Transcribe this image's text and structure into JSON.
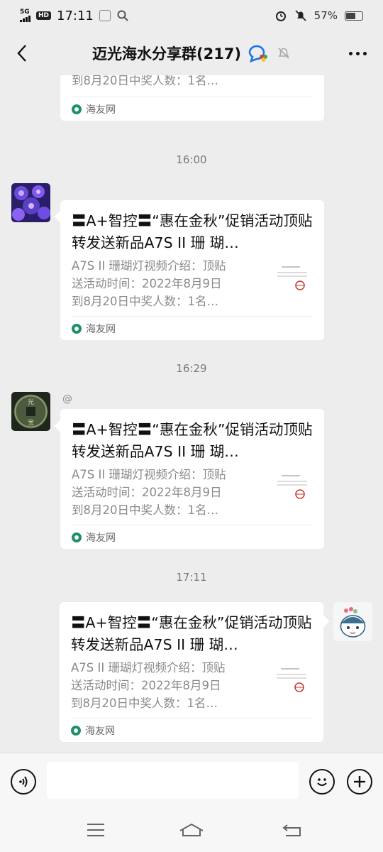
{
  "status_bar": {
    "network": "5G",
    "hd": "HD",
    "time": "17:11",
    "battery": "57%"
  },
  "header": {
    "title": "迈光海水分享群(217)"
  },
  "shared_card": {
    "title": "〓A+智控〓“惠在金秋”促销活动顶贴转发送新品A7S II 珊 瑚…",
    "desc_line1": "A7S II 珊瑚灯视频介绍：顶贴",
    "desc_line2": "送活动时间：2022年8月9日",
    "desc_line3": "到8月20日中奖人数：1名…",
    "source": "海友网"
  },
  "messages": [
    {
      "type": "timestamp",
      "text": "16:00"
    },
    {
      "type": "timestamp",
      "text": "16:29"
    },
    {
      "type": "at",
      "text": "@"
    },
    {
      "type": "timestamp",
      "text": "17:11"
    }
  ],
  "colors": {
    "background": "#ededed",
    "bubble": "#ffffff",
    "muted_text": "#8a8a8a",
    "accent_blue": "#1a73e8"
  }
}
